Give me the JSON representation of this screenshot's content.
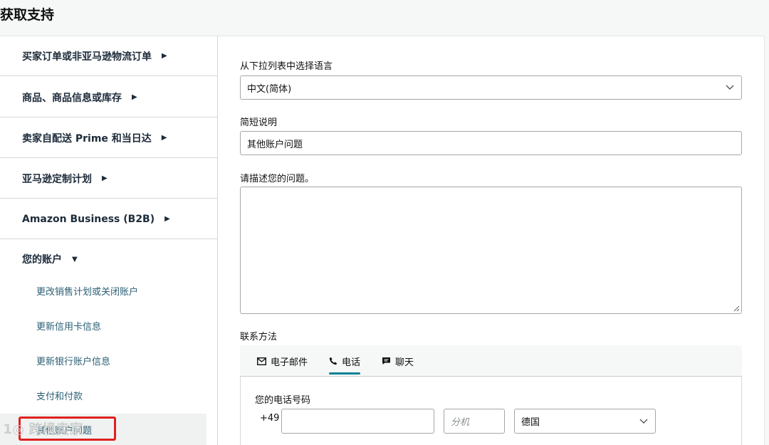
{
  "page": {
    "title": "获取支持"
  },
  "sidebar": {
    "categories": [
      {
        "label": "买家订单或非亚马逊物流订单",
        "arrow": "▶"
      },
      {
        "label": "商品、商品信息或库存",
        "arrow": "▶"
      },
      {
        "label": "卖家自配送 Prime 和当日达",
        "arrow": "▶"
      },
      {
        "label": "亚马逊定制计划",
        "arrow": "▶"
      },
      {
        "label": "Amazon Business (B2B)",
        "arrow": "▶"
      },
      {
        "label": "您的账户",
        "arrow": "▼"
      }
    ],
    "subitems": [
      {
        "label": "更改销售计划或关闭账户"
      },
      {
        "label": "更新信用卡信息"
      },
      {
        "label": "更新银行账户信息"
      },
      {
        "label": "支付和付款"
      },
      {
        "label": "其他账户问题"
      }
    ]
  },
  "watermark": {
    "text": "1◎ 跨境卖家"
  },
  "form": {
    "language_label": "从下拉列表中选择语言",
    "language_value": "中文(简体)",
    "summary_label": "简短说明",
    "summary_value": "其他账户问题",
    "description_label": "请描述您的问题。",
    "description_value": "",
    "contact_label": "联系方法",
    "tabs": [
      {
        "label": "电子邮件",
        "icon": "mail-icon"
      },
      {
        "label": "电话",
        "icon": "phone-icon"
      },
      {
        "label": "聊天",
        "icon": "chat-icon"
      }
    ],
    "active_tab": "电话",
    "phone": {
      "label": "您的电话号码",
      "country_code": "+49",
      "number_value": "",
      "extension_placeholder": "分机",
      "country_value": "德国"
    }
  },
  "colors": {
    "accent": "#008296",
    "link": "#2b5f74",
    "highlight": "#e02020"
  }
}
